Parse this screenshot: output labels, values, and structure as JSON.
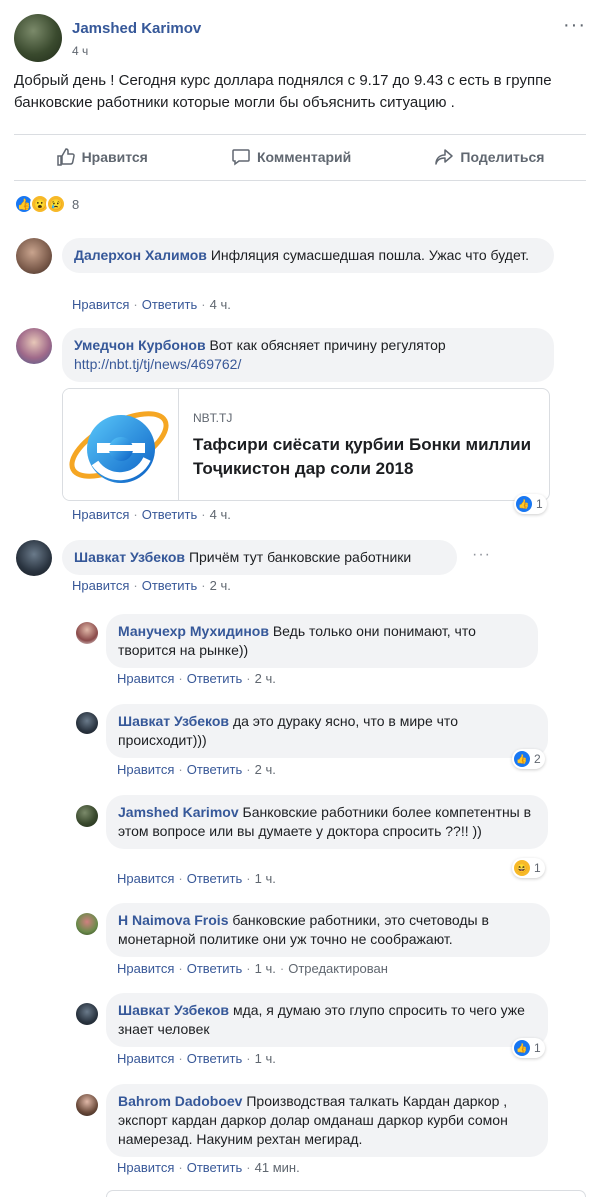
{
  "post": {
    "author": "Jamshed Karimov",
    "time": "4 ч",
    "more": "···",
    "text": "Добрый день ! Сегодня курс доллара поднялся с 9.17 до 9.43 с есть в группе банковские работники которые могли бы объяснить ситуацию .",
    "actions": {
      "like": "Нравится",
      "comment": "Комментарий",
      "share": "Поделиться"
    },
    "reaction_count": "8"
  },
  "meta_labels": {
    "like": "Нравится",
    "reply": "Ответить",
    "sep": "·"
  },
  "comments": [
    {
      "author": "Далерхон Халимов",
      "text": "Инфляция сумасшедшая пошла. Ужас что будет.",
      "time": "4 ч."
    },
    {
      "author": "Умедчон Курбонов",
      "text": "Вот как обясняет причину регулятор",
      "link": "http://nbt.tj/tj/news/469762/",
      "time": "4 ч.",
      "likes": "1",
      "card": {
        "domain": "NBT.TJ",
        "title": "Тафсири сиёсати қурбии Бонки миллии Тоҷикистон дар соли 2018"
      }
    },
    {
      "author": "Шавкат Узбеков",
      "text": "Причём тут банковские работники",
      "time": "2 ч.",
      "more": "···"
    }
  ],
  "replies": [
    {
      "author": "Манучехр Мухидинов",
      "text": "Ведь только они понимают, что творится на рынке))",
      "time": "2 ч."
    },
    {
      "author": "Шавкат Узбеков",
      "text": "да это дураку ясно, что в мире что происходит)))",
      "time": "2 ч.",
      "likes": "2"
    },
    {
      "author": "Jamshed Karimov",
      "text": "Банковские работники более компетентны в этом вопросе или вы думаете у доктора спросить ??!! ))",
      "time": "1 ч.",
      "likes": "1"
    },
    {
      "author": "H Naimova Frois",
      "text": "банковские работники, это счетоводы в монетарной политике они уж точно не соображают.",
      "time": "1 ч.",
      "edited": "Отредактирован"
    },
    {
      "author": "Шавкат Узбеков",
      "text": "мда, я думаю это глупо спросить то чего уже знает человек",
      "time": "1 ч.",
      "likes": "1"
    },
    {
      "author": "Bahrom Dadoboev",
      "text": "Производствая талкать Кардан даркор , экспорт кардан даркор долар омданаш даркор курби сомон намерезад. Накуним рехтан мегирад.",
      "time": "41 мин."
    }
  ],
  "colors": {
    "link_blue": "#365899",
    "like_blue": "#1877f2",
    "bubble_gray": "#f2f3f5",
    "haha_yellow": "#f7b928"
  },
  "icons": [
    "like-icon",
    "comment-icon",
    "share-icon",
    "wow-icon",
    "sad-icon",
    "haha-icon",
    "ie-logo-icon"
  ]
}
